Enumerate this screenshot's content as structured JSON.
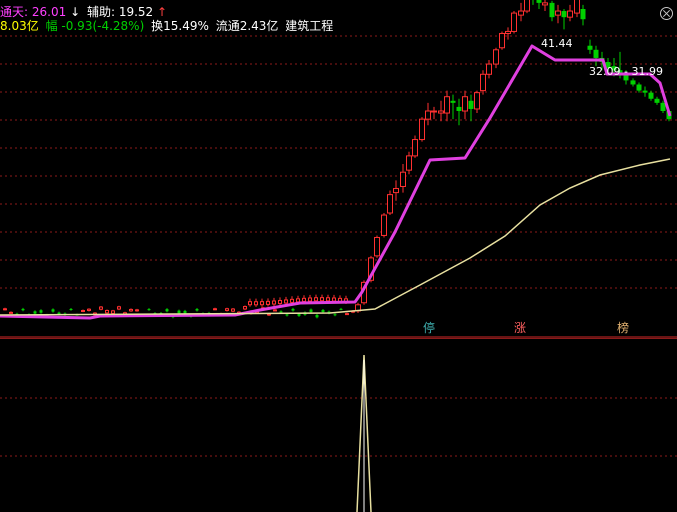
{
  "header": {
    "line1_label": "通天:",
    "line1_value": "26.01",
    "line1_arrow": "↓",
    "aux_label": "辅助:",
    "aux_value": "19.52",
    "aux_arrow": "↑",
    "line2_amount": "8.03亿",
    "line2_change_label": "幅",
    "line2_change": "-0.93(-4.28%)",
    "line2_turnover": "换15.49%",
    "line2_float": "流通2.43亿",
    "line2_name": "建筑工程"
  },
  "markers": {
    "ting": "停",
    "zhang": "涨",
    "bang": "榜"
  },
  "price_labels": {
    "high": "41.44",
    "range": "32.09 - 31.99"
  },
  "colors": {
    "up": "#ff3030",
    "down": "#00d000",
    "magenta": "#e040e0",
    "ma": "#e8e0a0",
    "grid": "#8b1a1a",
    "ting_color": "#40b0b0",
    "zhang_color": "#ff6060",
    "bang_color": "#e0b070"
  },
  "chart_data": {
    "type": "candlestick",
    "series": [
      {
        "name": "通天",
        "values": [
          28.5,
          28.5,
          28.6,
          29.2,
          34,
          41.5,
          41.5,
          41.5,
          39.5,
          32.5
        ]
      },
      {
        "name": "辅助",
        "values": [
          28.6,
          28.6,
          28.7,
          28.9,
          31,
          34,
          36,
          37.5,
          38.2,
          38.8
        ]
      }
    ]
  }
}
